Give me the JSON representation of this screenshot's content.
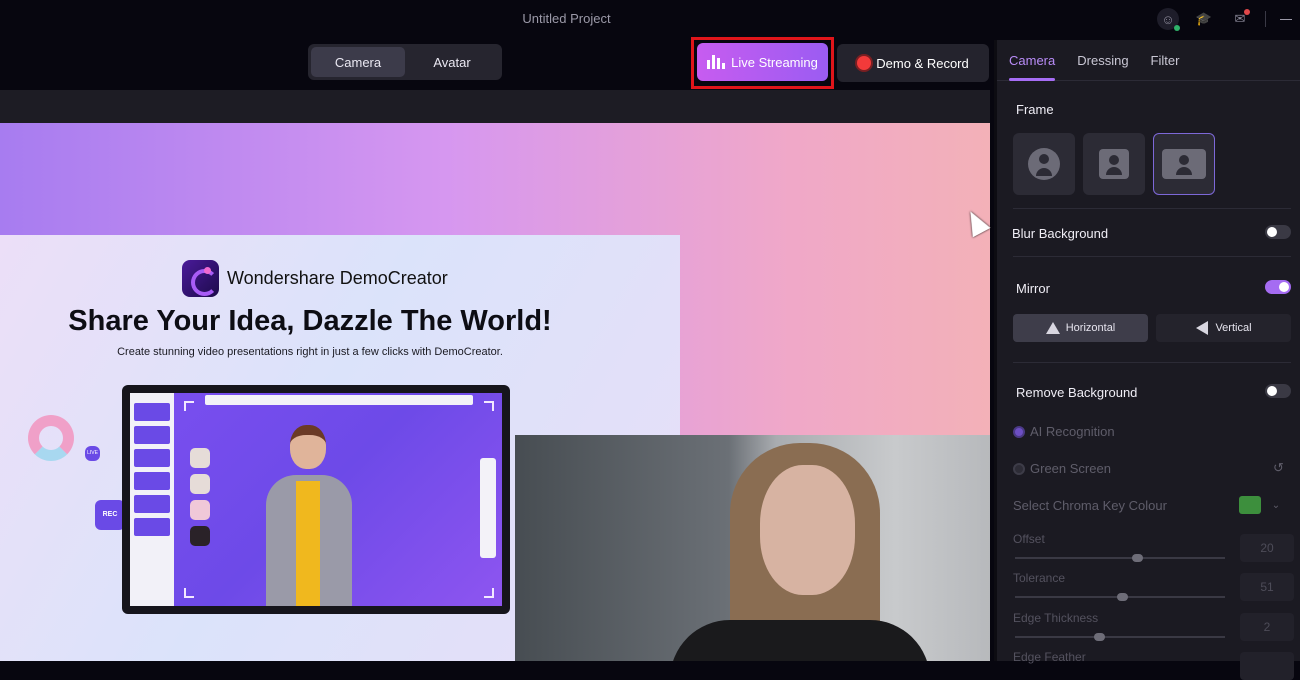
{
  "window": {
    "title": "Untitled Project",
    "icons": [
      "user-account-icon",
      "academy-cap-icon",
      "mail-icon",
      "minimize-icon"
    ]
  },
  "toolbar": {
    "mode_tabs": [
      {
        "label": "Camera",
        "active": true
      },
      {
        "label": "Avatar",
        "active": false
      }
    ],
    "live_streaming_label": "Live Streaming",
    "demo_record_label": "Demo & Record",
    "accent_color": "#b35cf0",
    "highlight_color": "#e0151a"
  },
  "canvas": {
    "slide": {
      "brand": "Wondershare DemoCreator",
      "headline": "Share Your Idea, Dazzle The World!",
      "subline": "Create stunning video presentations right in just a few clicks with DemoCreator.",
      "rec_badge": "REC",
      "live_badge": "LIVE"
    }
  },
  "panel": {
    "tabs": [
      {
        "label": "Camera",
        "active": true
      },
      {
        "label": "Dressing",
        "active": false
      },
      {
        "label": "Filter",
        "active": false
      }
    ],
    "frame": {
      "label": "Frame",
      "options": [
        "circle",
        "square",
        "rectangle"
      ],
      "selected": "rectangle"
    },
    "blur_background": {
      "label": "Blur Background",
      "enabled": false
    },
    "mirror": {
      "label": "Mirror",
      "enabled": true,
      "options": [
        {
          "label": "Horizontal",
          "active": true
        },
        {
          "label": "Vertical",
          "active": false
        }
      ]
    },
    "remove_background": {
      "label": "Remove Background",
      "enabled": false,
      "modes": [
        {
          "label": "AI Recognition",
          "checked": true
        },
        {
          "label": "Green Screen",
          "checked": false
        }
      ],
      "chroma_key": {
        "label": "Select Chroma Key Colour",
        "color": "#3d8f3d"
      },
      "sliders": [
        {
          "label": "Offset",
          "value": 20,
          "fraction": 0.58
        },
        {
          "label": "Tolerance",
          "value": 51,
          "fraction": 0.51
        },
        {
          "label": "Edge Thickness",
          "value": 2,
          "fraction": 0.4
        },
        {
          "label": "Edge Feather",
          "value": null,
          "fraction": null
        }
      ]
    }
  }
}
